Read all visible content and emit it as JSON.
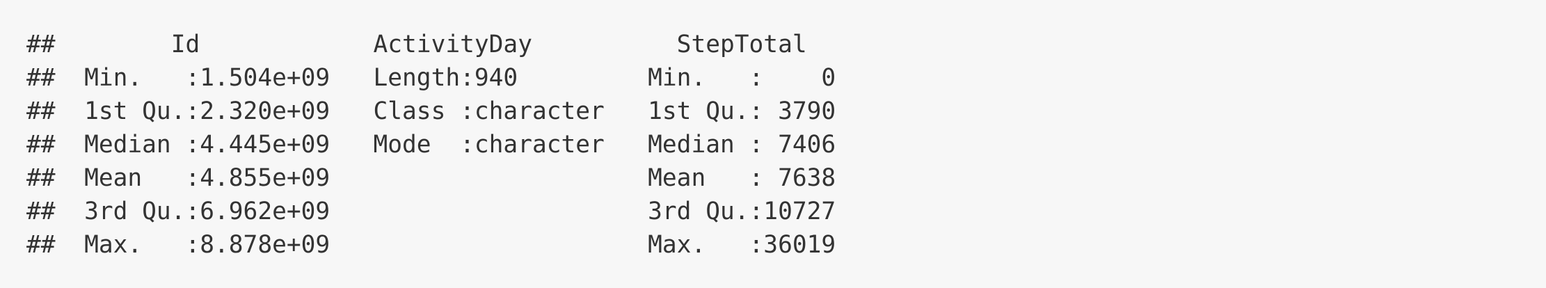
{
  "console": {
    "lines": [
      "##        Id            ActivityDay          StepTotal    ",
      "##  Min.   :1.504e+09   Length:940         Min.   :    0  ",
      "##  1st Qu.:2.320e+09   Class :character   1st Qu.: 3790  ",
      "##  Median :4.445e+09   Mode  :character   Median : 7406  ",
      "##  Mean   :4.855e+09                      Mean   : 7638  ",
      "##  3rd Qu.:6.962e+09                      3rd Qu.:10727  ",
      "##  Max.   :8.878e+09                      Max.   :36019  "
    ]
  }
}
